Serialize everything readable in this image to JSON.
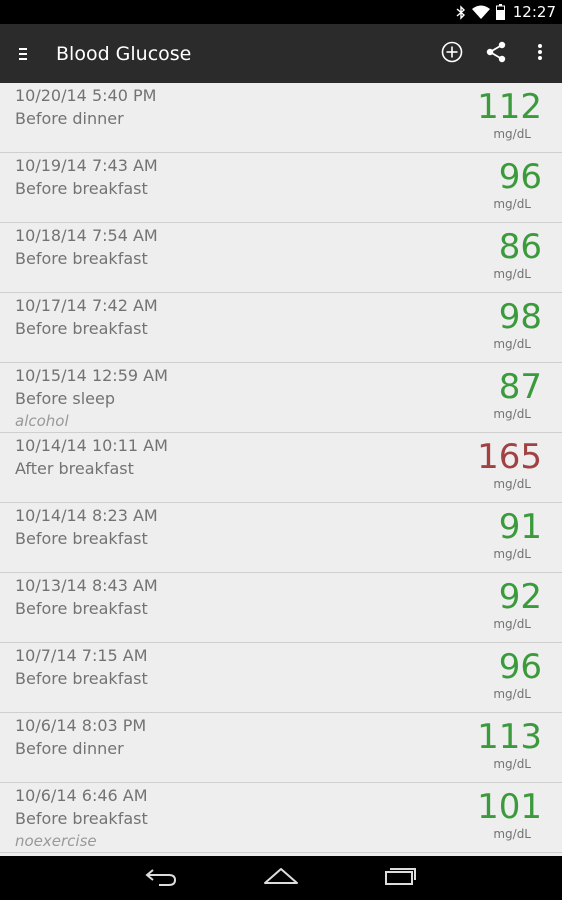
{
  "status_bar": {
    "time": "12:27",
    "icons": [
      "bluetooth-icon",
      "wifi-icon",
      "battery-icon"
    ]
  },
  "action_bar": {
    "title": "Blood Glucose",
    "icons": [
      "menu-icon",
      "add-circle-icon",
      "share-icon",
      "overflow-menu-icon"
    ]
  },
  "colors": {
    "in_range": "#3b9a3b",
    "high": "#a14141",
    "action_bar": "#2b2b2b",
    "list_background": "#eeeeee"
  },
  "readings": [
    {
      "date": "10/20/14 5:40 PM",
      "meal": "Before dinner",
      "note": "",
      "value": "112",
      "unit": "mg/dL",
      "status": "in_range"
    },
    {
      "date": "10/19/14 7:43 AM",
      "meal": "Before breakfast",
      "note": "",
      "value": "96",
      "unit": "mg/dL",
      "status": "in_range"
    },
    {
      "date": "10/18/14 7:54 AM",
      "meal": "Before breakfast",
      "note": "",
      "value": "86",
      "unit": "mg/dL",
      "status": "in_range"
    },
    {
      "date": "10/17/14 7:42 AM",
      "meal": "Before breakfast",
      "note": "",
      "value": "98",
      "unit": "mg/dL",
      "status": "in_range"
    },
    {
      "date": "10/15/14 12:59 AM",
      "meal": "Before sleep",
      "note": "alcohol",
      "value": "87",
      "unit": "mg/dL",
      "status": "in_range"
    },
    {
      "date": "10/14/14 10:11 AM",
      "meal": "After breakfast",
      "note": "",
      "value": "165",
      "unit": "mg/dL",
      "status": "high"
    },
    {
      "date": "10/14/14 8:23 AM",
      "meal": "Before breakfast",
      "note": "",
      "value": "91",
      "unit": "mg/dL",
      "status": "in_range"
    },
    {
      "date": "10/13/14 8:43 AM",
      "meal": "Before breakfast",
      "note": "",
      "value": "92",
      "unit": "mg/dL",
      "status": "in_range"
    },
    {
      "date": "10/7/14 7:15 AM",
      "meal": "Before breakfast",
      "note": "",
      "value": "96",
      "unit": "mg/dL",
      "status": "in_range"
    },
    {
      "date": "10/6/14 8:03 PM",
      "meal": "Before dinner",
      "note": "",
      "value": "113",
      "unit": "mg/dL",
      "status": "in_range"
    },
    {
      "date": "10/6/14 6:46 AM",
      "meal": "Before breakfast",
      "note": "noexercise",
      "value": "101",
      "unit": "mg/dL",
      "status": "in_range"
    }
  ],
  "nav_bar": {
    "icons": [
      "back-icon",
      "home-icon",
      "recents-icon"
    ]
  }
}
